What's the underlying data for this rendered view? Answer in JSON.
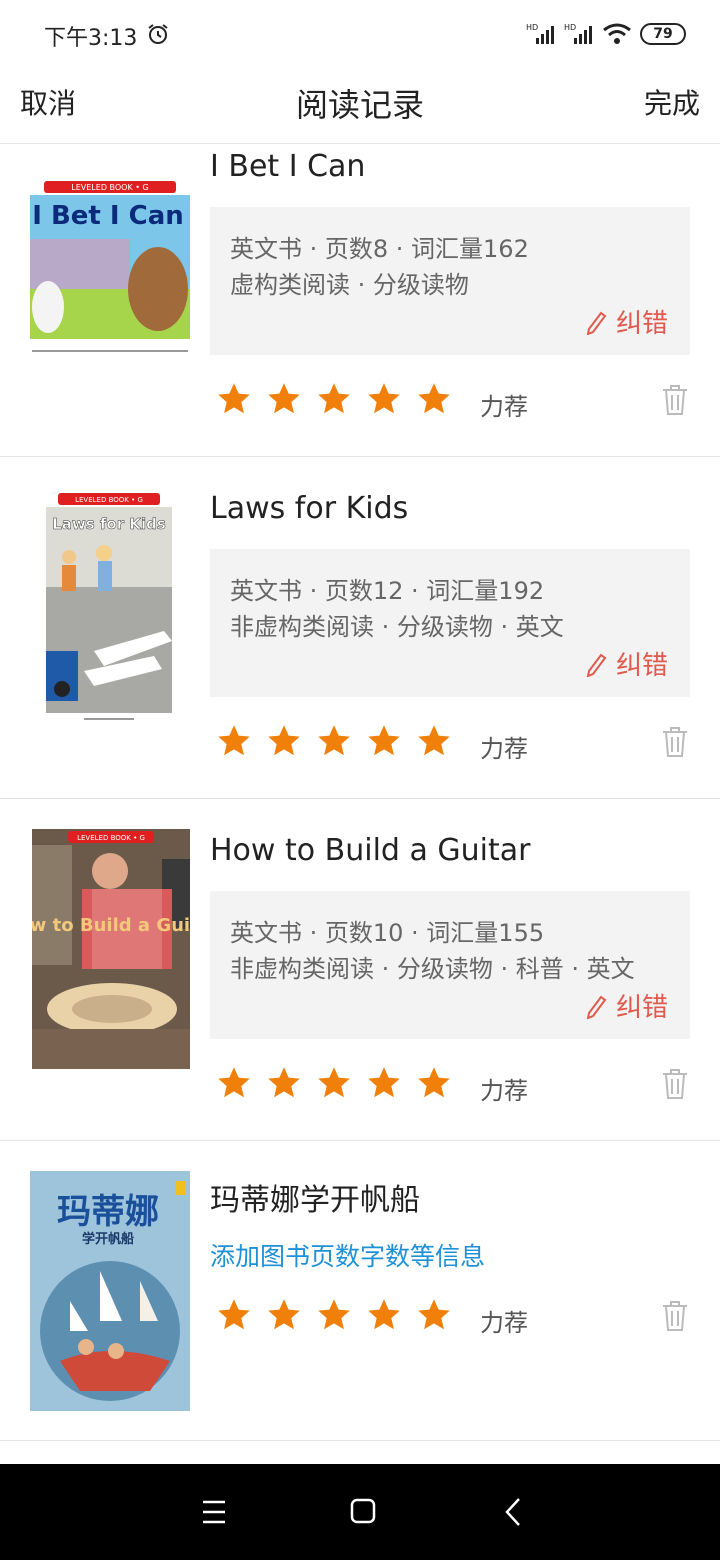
{
  "status_bar": {
    "time": "下午3:13",
    "network_1": "HD",
    "network_2": "HD",
    "battery": "79"
  },
  "header": {
    "cancel_label": "取消",
    "title": "阅读记录",
    "done_label": "完成"
  },
  "books": [
    {
      "title": "I Bet I Can",
      "info_line1": "英文书 · 页数8 · 词汇量162",
      "info_line2": "虚构类阅读 · 分级读物",
      "correct_label": "纠错",
      "recommend_label": "力荐",
      "stars": 5,
      "cover_text": "I Bet I Can",
      "cover_series": "LEVELED BOOK • G"
    },
    {
      "title": "Laws for Kids",
      "info_line1": "英文书 · 页数12 · 词汇量192",
      "info_line2": "非虚构类阅读 · 分级读物 · 英文",
      "correct_label": "纠错",
      "recommend_label": "力荐",
      "stars": 5,
      "cover_text": "Laws for Kids",
      "cover_series": "LEVELED BOOK • G"
    },
    {
      "title": "How to Build a Guitar",
      "info_line1": "英文书 · 页数10 · 词汇量155",
      "info_line2": "非虚构类阅读 · 分级读物 · 科普 · 英文",
      "correct_label": "纠错",
      "recommend_label": "力荐",
      "stars": 5,
      "cover_text": "How to Build a Guitar",
      "cover_series": "LEVELED BOOK • G"
    },
    {
      "title": "玛蒂娜学开帆船",
      "add_info_link": "添加图书页数字数等信息",
      "recommend_label": "力荐",
      "stars": 5,
      "cover_text": "玛蒂娜",
      "cover_subtitle": "学开帆船"
    }
  ],
  "colors": {
    "star": "#f0800a",
    "correct": "#e05a4e",
    "link": "#1e90d6",
    "info_bg": "#f3f3f3"
  }
}
